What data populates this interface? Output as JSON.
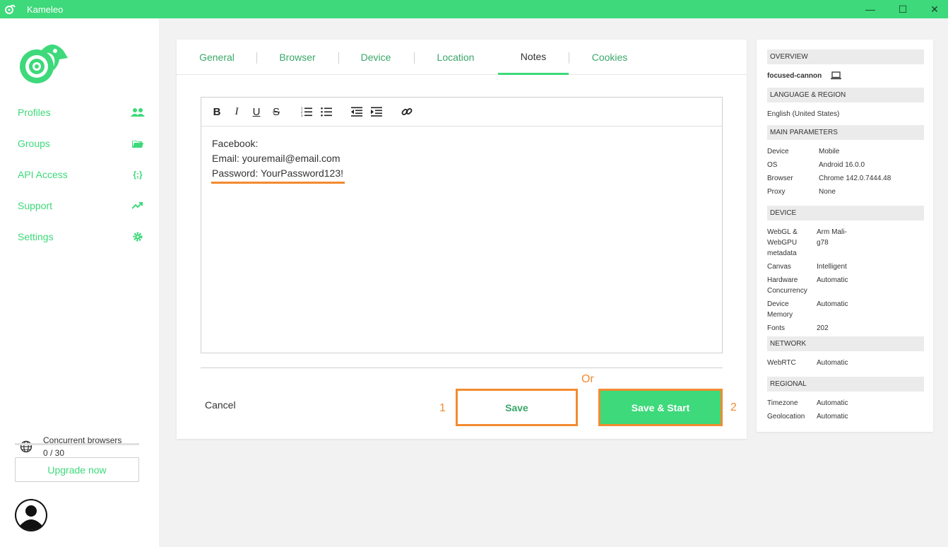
{
  "window": {
    "title": "Kameleo",
    "minimize_glyph": "—",
    "maximize_glyph": "☐",
    "close_glyph": "✕"
  },
  "sidebar": {
    "items": [
      {
        "label": "Profiles",
        "icon": "users-icon"
      },
      {
        "label": "Groups",
        "icon": "folder-icon"
      },
      {
        "label": "API Access",
        "icon": "code-braces-icon",
        "icon_text": "{;}"
      },
      {
        "label": "Support",
        "icon": "trending-up-icon"
      },
      {
        "label": "Settings",
        "icon": "gear-icon"
      }
    ],
    "concurrent_label": "Concurrent browsers",
    "concurrent_value": "0 / 30",
    "concurrent_fraction": 0,
    "upgrade_label": "Upgrade now"
  },
  "tabs": [
    {
      "label": "General",
      "active": false
    },
    {
      "label": "Browser",
      "active": false
    },
    {
      "label": "Device",
      "active": false
    },
    {
      "label": "Location",
      "active": false
    },
    {
      "label": "Notes",
      "active": true
    },
    {
      "label": "Cookies",
      "active": false
    }
  ],
  "editor": {
    "toolbar": {
      "bold": "B",
      "italic": "I",
      "underline": "U",
      "strike": "S"
    },
    "lines": [
      "Facebook:",
      "Email: youremail@email.com",
      "Password: YourPassword123!"
    ]
  },
  "actions": {
    "cancel_label": "Cancel",
    "save_label": "Save",
    "save_start_label": "Save & Start",
    "or_label": "Or",
    "step1_label": "1",
    "step2_label": "2"
  },
  "overview": {
    "overview_header": "OVERVIEW",
    "profile_name": "focused-cannon",
    "language_header": "LANGUAGE & REGION",
    "language_value": "English (United States)",
    "main_params_header": "MAIN PARAMETERS",
    "main_params": [
      {
        "key": "Device",
        "value": "Mobile"
      },
      {
        "key": "OS",
        "value": "Android 16.0.0"
      },
      {
        "key": "Browser",
        "value": "Chrome 142.0.7444.48"
      },
      {
        "key": "Proxy",
        "value": "None"
      }
    ],
    "device_header": "DEVICE",
    "device_params": [
      {
        "key": "WebGL & WebGPU metadata",
        "value": "Arm Mali-g78"
      },
      {
        "key": "Canvas",
        "value": "Intelligent"
      },
      {
        "key": "Hardware Concurrency",
        "value": "Automatic"
      },
      {
        "key": "Device Memory",
        "value": "Automatic"
      },
      {
        "key": "Fonts",
        "value": "202"
      }
    ],
    "network_header": "NETWORK",
    "network_params": [
      {
        "key": "WebRTC",
        "value": "Automatic"
      }
    ],
    "regional_header": "REGIONAL",
    "regional_params": [
      {
        "key": "Timezone",
        "value": "Automatic"
      },
      {
        "key": "Geolocation",
        "value": "Automatic"
      }
    ]
  },
  "colors": {
    "brand_green": "#3dd97a",
    "annotation_orange": "#f28b30"
  }
}
